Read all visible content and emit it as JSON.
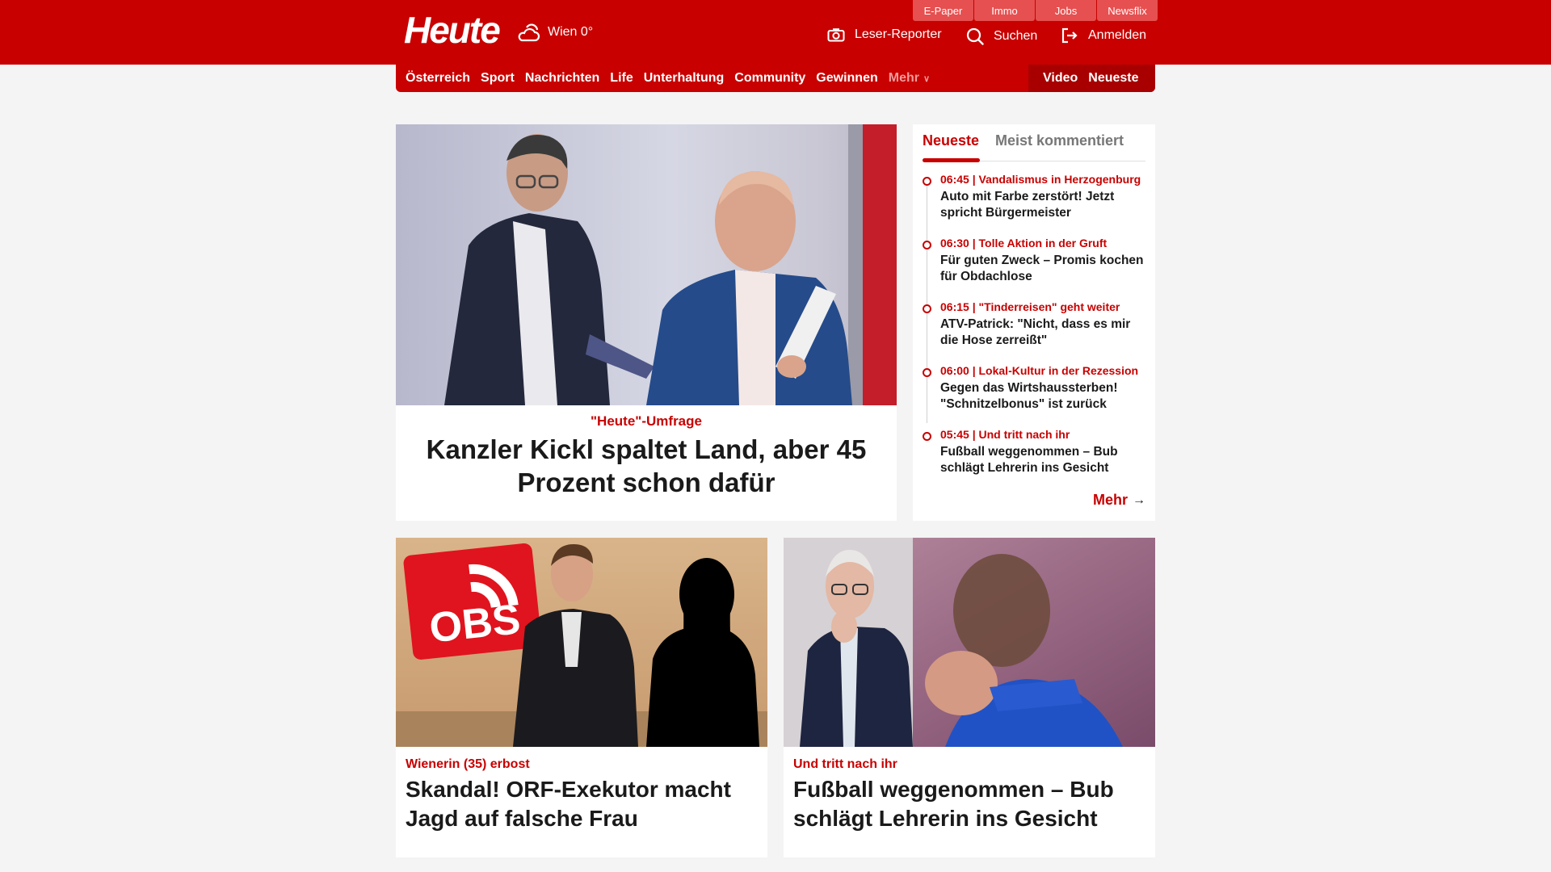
{
  "header": {
    "logo": "Heute",
    "weather": "Wien 0°",
    "top_links": [
      "E-Paper",
      "Immo",
      "Jobs",
      "Newsflix"
    ],
    "leser_reporter": "Leser-Reporter",
    "search": "Suchen",
    "login": "Anmelden",
    "brand_color": "#c80000"
  },
  "nav": {
    "items": [
      "Österreich",
      "Sport",
      "Nachrichten",
      "Life",
      "Unterhaltung",
      "Community",
      "Gewinnen"
    ],
    "more": "Mehr",
    "right": [
      "Video",
      "Neueste"
    ]
  },
  "hero": {
    "kicker": "\"Heute\"-Umfrage",
    "title": "Kanzler Kickl spaltet Land, aber 45 Prozent schon dafür"
  },
  "sidebar": {
    "tabs": [
      "Neueste",
      "Meist kommentiert"
    ],
    "items": [
      {
        "meta": "06:45 | Vandalismus in Herzogenburg",
        "title": "Auto mit Farbe zerstört! Jetzt spricht Bürgermeister"
      },
      {
        "meta": "06:30 | Tolle Aktion in der Gruft",
        "title": "Für guten Zweck – Promis kochen für Obdachlose"
      },
      {
        "meta": "06:15 | \"Tinderreisen\" geht weiter",
        "title": "ATV-Patrick: \"Nicht, dass es mir die Hose zerreißt\""
      },
      {
        "meta": "06:00 | Lokal-Kultur in der Rezession",
        "title": "Gegen das Wirtshaussterben! \"Schnitzelbonus\" ist zurück"
      },
      {
        "meta": "05:45 | Und tritt nach ihr",
        "title": "Fußball weggenommen – Bub schlägt Lehrerin ins Gesicht"
      }
    ],
    "more": "Mehr"
  },
  "cards": [
    {
      "kicker": "Wienerin (35) erbost",
      "title": "Skandal! ORF-Exekutor macht Jagd auf falsche Frau",
      "logo_text": "OBS"
    },
    {
      "kicker": "Und tritt nach ihr",
      "title": "Fußball weggenommen – Bub schlägt Lehrerin ins Gesicht"
    }
  ]
}
